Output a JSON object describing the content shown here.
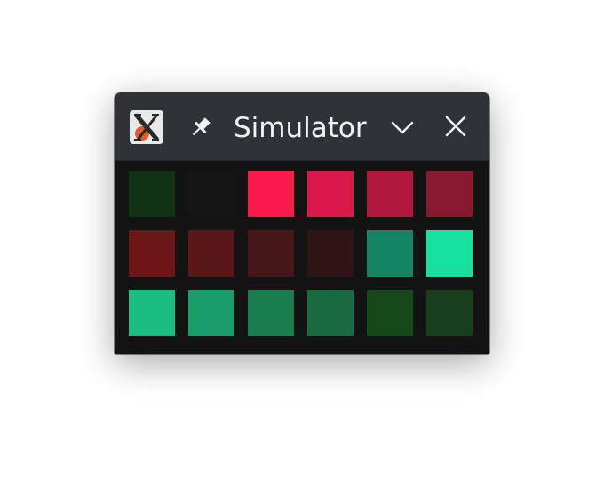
{
  "window": {
    "title": "Simulator",
    "app_icon": "x-app-icon",
    "buttons": {
      "pin": "pin-icon",
      "menu": "chevron-down-icon",
      "close": "close-icon"
    }
  },
  "grid": {
    "rows": 3,
    "columns": 6,
    "cells": [
      "#113315",
      "#141414",
      "#fb1a4c",
      "#d8194a",
      "#b2183d",
      "#87182e",
      "#6e1518",
      "#5a1717",
      "#461718",
      "#2f1415",
      "#148563",
      "#16e19f",
      "#1bbd80",
      "#1a9b6a",
      "#177d4e",
      "#196a41",
      "#154b1a",
      "#183f1d"
    ]
  }
}
